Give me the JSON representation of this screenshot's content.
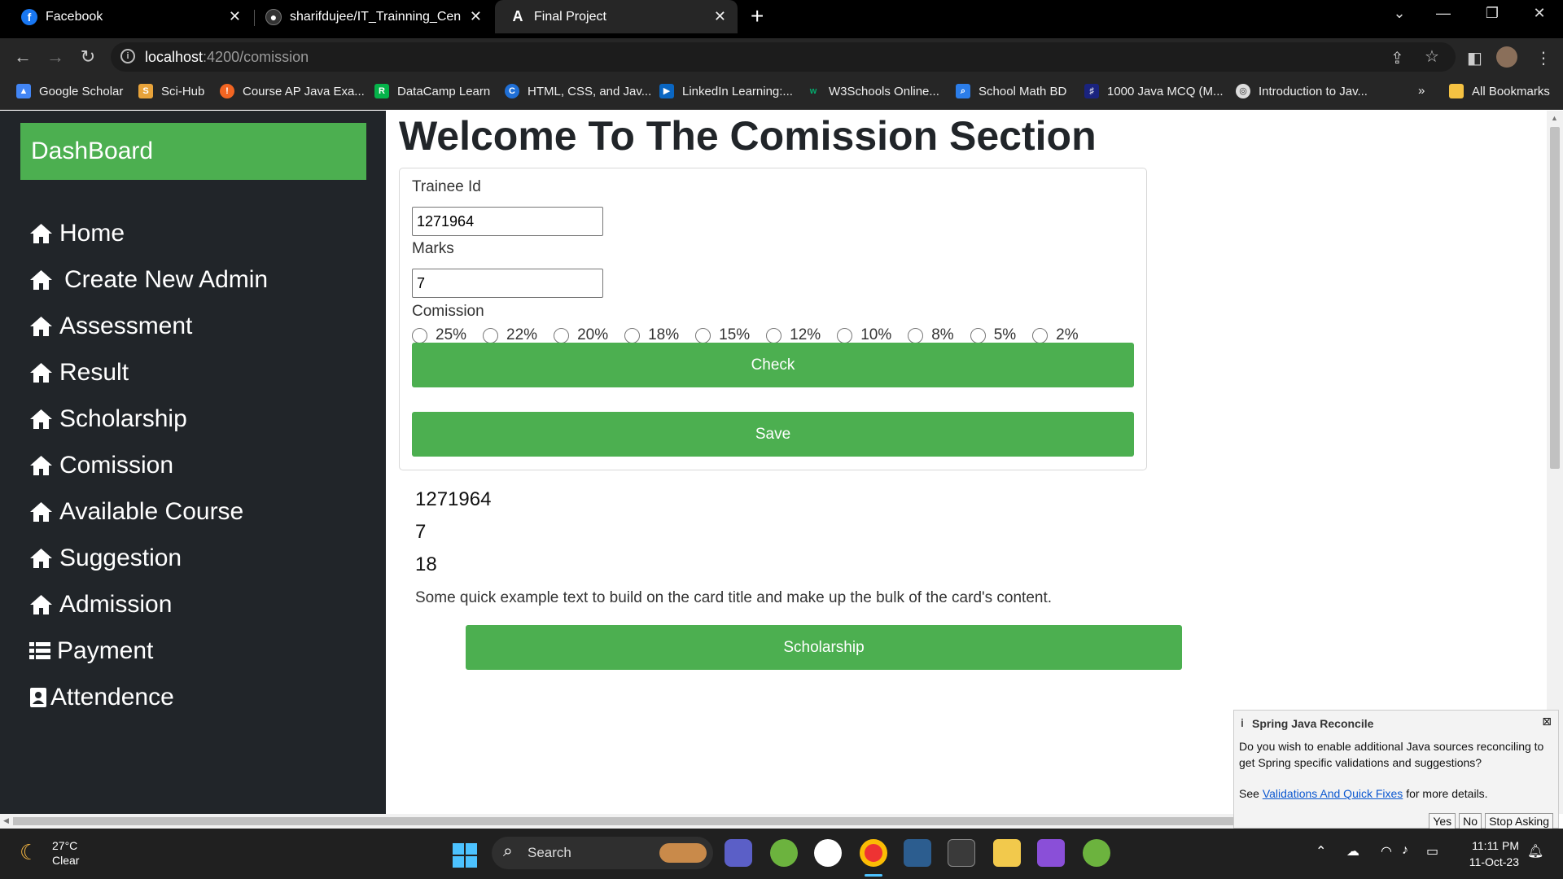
{
  "browser": {
    "tabs": [
      {
        "title": "Facebook",
        "active": false
      },
      {
        "title": "sharifdujee/IT_Trainning_Center_",
        "active": false
      },
      {
        "title": "Final Project",
        "active": true
      }
    ],
    "new_tab_symbol": "+",
    "url_host": "localhost",
    "url_path": ":4200/comission",
    "bookmarks": [
      "Google Scholar",
      "Sci-Hub",
      "Course AP Java Exa...",
      "DataCamp Learn",
      "HTML, CSS, and Jav...",
      "LinkedIn Learning:...",
      "W3Schools Online...",
      "School Math BD",
      "1000 Java MCQ (M...",
      "Introduction to Jav..."
    ],
    "bookmarks_overflow": "»",
    "all_bookmarks": "All Bookmarks"
  },
  "sidebar": {
    "brand": "DashBoard",
    "items": [
      {
        "label": "Home"
      },
      {
        "label": "Create New Admin"
      },
      {
        "label": "Assessment"
      },
      {
        "label": "Result"
      },
      {
        "label": "Scholarship"
      },
      {
        "label": "Comission"
      },
      {
        "label": "Available Course"
      },
      {
        "label": "Suggestion"
      },
      {
        "label": "Admission"
      },
      {
        "label": "Payment"
      },
      {
        "label": "Attendence"
      }
    ]
  },
  "main": {
    "title": "Welcome To The Comission Section",
    "form": {
      "trainee_label": "Trainee Id",
      "trainee_value": "1271964",
      "marks_label": "Marks",
      "marks_value": "7",
      "comission_label": "Comission",
      "comission_options": [
        "25%",
        "22%",
        "20%",
        "18%",
        "15%",
        "12%",
        "10%",
        "8%",
        "5%",
        "2%"
      ],
      "check_label": "Check",
      "save_label": "Save"
    },
    "result": {
      "trainee_id": "1271964",
      "marks": "7",
      "comission": "18",
      "card_text": "Some quick example text to build on the card title and make up the bulk of the card's content."
    },
    "scholarship_button": "Scholarship"
  },
  "notification": {
    "title": "Spring Java Reconcile",
    "body": "Do you wish to enable additional Java sources reconciling to get Spring specific validations and suggestions?",
    "see_prefix": "See",
    "link_text": "Validations And Quick Fixes",
    "see_suffix": "for more details.",
    "buttons": [
      "Yes",
      "No",
      "Stop Asking"
    ]
  },
  "taskbar": {
    "weather_temp": "27°C",
    "weather_desc": "Clear",
    "search_placeholder": "Search",
    "time": "11:11 PM",
    "date": "11-Oct-23"
  },
  "colors": {
    "accent_green": "#4caf50",
    "sidebar_bg": "#212529"
  }
}
